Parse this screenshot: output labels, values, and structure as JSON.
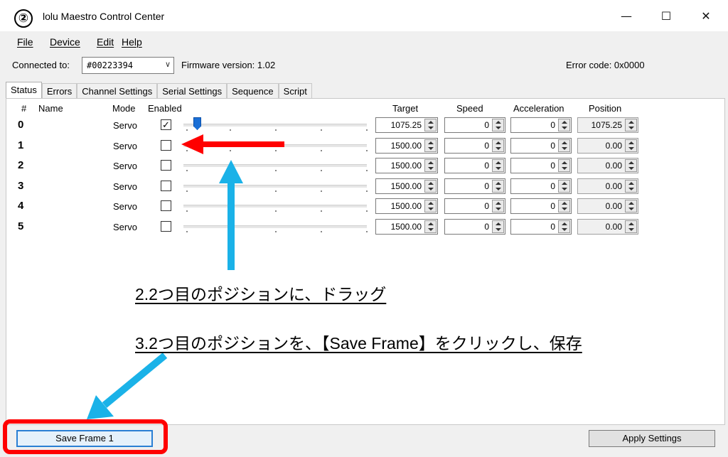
{
  "annotation_badge": "②",
  "window": {
    "title": "lolu Maestro Control Center",
    "minimize": "—",
    "maximize": "☐",
    "close": "✕"
  },
  "menu": [
    "File",
    "Device",
    "Edit",
    "Help"
  ],
  "connection": {
    "label": "Connected to:",
    "device": "#00223394",
    "firmware": "Firmware version: 1.02",
    "error_code": "Error code:  0x0000"
  },
  "tabs": [
    "Status",
    "Errors",
    "Channel Settings",
    "Serial Settings",
    "Sequence",
    "Script"
  ],
  "active_tab": "Status",
  "columns": {
    "num": "#",
    "name": "Name",
    "mode": "Mode",
    "enabled": "Enabled",
    "target": "Target",
    "speed": "Speed",
    "acceleration": "Acceleration",
    "position": "Position"
  },
  "channels": [
    {
      "num": "0",
      "mode": "Servo",
      "enabled": true,
      "checkbox": "✓",
      "target": "1075.25",
      "speed": "0",
      "acceleration": "0",
      "position": "1075.25"
    },
    {
      "num": "1",
      "mode": "Servo",
      "enabled": false,
      "checkbox": "",
      "target": "1500.00",
      "speed": "0",
      "acceleration": "0",
      "position": "0.00"
    },
    {
      "num": "2",
      "mode": "Servo",
      "enabled": false,
      "checkbox": "",
      "target": "1500.00",
      "speed": "0",
      "acceleration": "0",
      "position": "0.00"
    },
    {
      "num": "3",
      "mode": "Servo",
      "enabled": false,
      "checkbox": "",
      "target": "1500.00",
      "speed": "0",
      "acceleration": "0",
      "position": "0.00"
    },
    {
      "num": "4",
      "mode": "Servo",
      "enabled": false,
      "checkbox": "",
      "target": "1500.00",
      "speed": "0",
      "acceleration": "0",
      "position": "0.00"
    },
    {
      "num": "5",
      "mode": "Servo",
      "enabled": false,
      "checkbox": "",
      "target": "1500.00",
      "speed": "0",
      "acceleration": "0",
      "position": "0.00"
    }
  ],
  "instructions": [
    "2.2つ目のポジションに、ドラッグ",
    "3.2つ目のポジションを、【Save Frame】をクリックし、保存"
  ],
  "buttons": {
    "save_frame": "Save Frame 1",
    "apply_settings": "Apply Settings"
  },
  "colors": {
    "red_annotation": "#ff0000",
    "blue_annotation": "#1ab2e8",
    "slider_thumb": "#1a6fd6"
  }
}
